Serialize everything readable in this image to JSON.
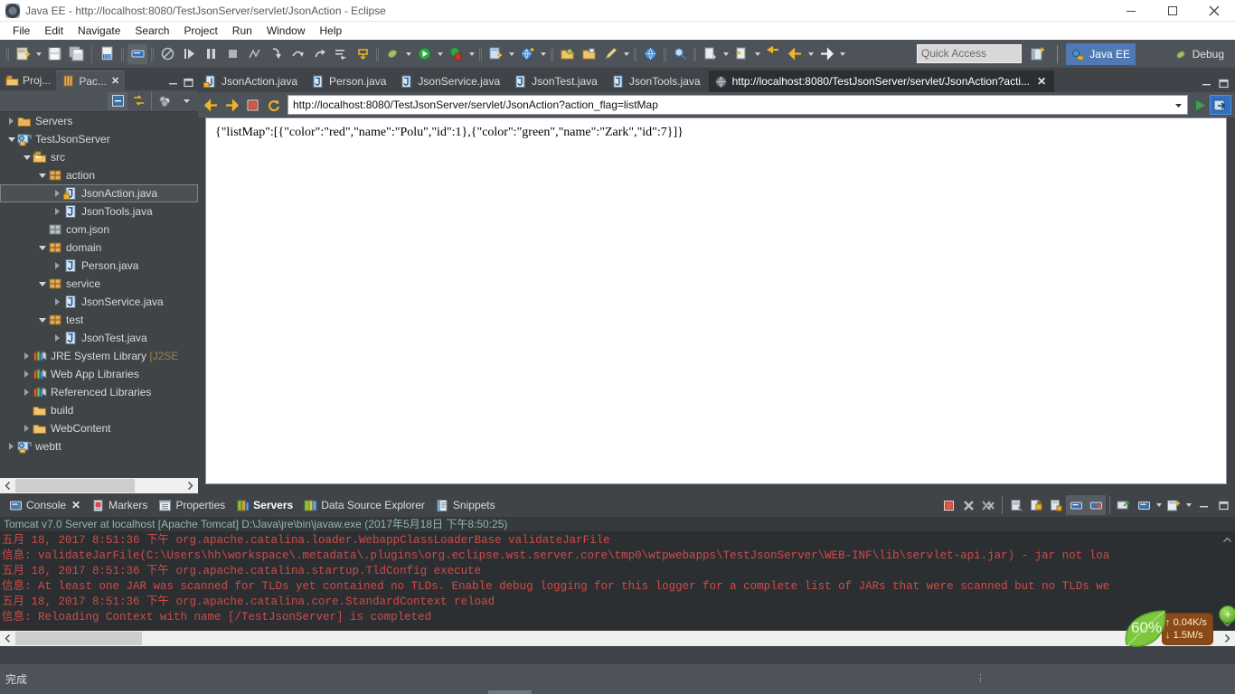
{
  "window": {
    "title": "Java EE - http://localhost:8080/TestJsonServer/servlet/JsonAction - Eclipse",
    "app_icon": "eclipse-icon",
    "minimize_label": "–",
    "restore_label": "❐",
    "close_label": "✕"
  },
  "menubar": {
    "items": [
      {
        "label": "File"
      },
      {
        "label": "Edit"
      },
      {
        "label": "Navigate"
      },
      {
        "label": "Search"
      },
      {
        "label": "Project"
      },
      {
        "label": "Run"
      },
      {
        "label": "Window"
      },
      {
        "label": "Help"
      }
    ]
  },
  "toolbar": {
    "quick_access_placeholder": "Quick Access",
    "open_perspective_icon": "open-perspective-icon",
    "perspectives": [
      {
        "label": "Java EE",
        "icon": "java-ee-perspective-icon",
        "active": true
      },
      {
        "label": "Debug",
        "icon": "debug-perspective-icon",
        "active": false
      }
    ],
    "groups": [
      {
        "icons": [
          "new-wizard-icon",
          "new-dropdown-icon",
          "save-icon",
          "save-all-icon"
        ]
      },
      {
        "icons": [
          "new-java-class-icon",
          "toggle-breakpoint-icon"
        ]
      },
      {
        "icons": [
          "skip-breakpoints-icon",
          "resume-icon",
          "suspend-icon",
          "terminate-icon",
          "disconnect-icon",
          "step-into-icon",
          "step-over-icon",
          "step-return-icon",
          "run-to-line-icon",
          "drop-to-frame-icon"
        ]
      },
      {
        "icons": [
          "external-tools-icon",
          "external-tools-dropdown-icon",
          "run-icon",
          "run-dropdown-icon",
          "debug-icon",
          "debug-dropdown-icon"
        ]
      },
      {
        "icons": [
          "new-ee-project-icon",
          "new-ee-dropdown-icon",
          "new-server-icon",
          "new-server-dropdown-icon"
        ]
      },
      {
        "icons": [
          "open-type-icon",
          "open-task-icon",
          "edit-icon",
          "edit-dropdown-icon"
        ]
      },
      {
        "icons": [
          "web-browser-icon"
        ]
      },
      {
        "icons": [
          "search-icon"
        ]
      },
      {
        "icons": [
          "next-annotation-icon",
          "previous-annotation-icon",
          "last-edit-location-icon"
        ]
      },
      {
        "icons": [
          "back-icon",
          "back-dropdown-icon",
          "forward-icon",
          "forward-dropdown-icon"
        ]
      }
    ]
  },
  "explorer": {
    "tabs": [
      {
        "label": "Proj...",
        "icon": "project-explorer-icon",
        "selected": false,
        "closable": false
      },
      {
        "label": "Pac...",
        "icon": "package-explorer-icon",
        "selected": true,
        "closable": true,
        "close_label": "✕"
      }
    ],
    "view_tools": [
      {
        "icon": "minimize-view-icon",
        "label": "–"
      },
      {
        "icon": "maximize-view-icon",
        "label": "❐"
      }
    ],
    "toolbar_icons": [
      {
        "icon": "collapse-all-icon"
      },
      {
        "icon": "link-with-editor-icon"
      },
      {
        "icon": "view-menu-filters-icon"
      },
      {
        "icon": "view-menu-icon"
      }
    ],
    "tree": [
      {
        "label": "Servers",
        "icon": "server-folder-icon",
        "indent": 0,
        "twisty": "closed",
        "selected": false
      },
      {
        "label": "TestJsonServer",
        "icon": "dynamic-web-project-icon",
        "indent": 0,
        "twisty": "open",
        "selected": false
      },
      {
        "label": "src",
        "icon": "source-folder-icon",
        "indent": 1,
        "twisty": "open",
        "selected": false
      },
      {
        "label": "action",
        "icon": "package-icon",
        "indent": 2,
        "twisty": "open",
        "selected": false
      },
      {
        "label": "JsonAction.java",
        "icon": "java-class-locked-icon",
        "indent": 3,
        "twisty": "closed",
        "selected": true
      },
      {
        "label": "JsonTools.java",
        "icon": "java-class-icon",
        "indent": 3,
        "twisty": "closed",
        "selected": false
      },
      {
        "label": "com.json",
        "icon": "package-empty-icon",
        "indent": 2,
        "twisty": "none",
        "selected": false
      },
      {
        "label": "domain",
        "icon": "package-icon",
        "indent": 2,
        "twisty": "open",
        "selected": false
      },
      {
        "label": "Person.java",
        "icon": "java-class-icon",
        "indent": 3,
        "twisty": "closed",
        "selected": false
      },
      {
        "label": "service",
        "icon": "package-icon",
        "indent": 2,
        "twisty": "open",
        "selected": false
      },
      {
        "label": "JsonService.java",
        "icon": "java-class-icon",
        "indent": 3,
        "twisty": "closed",
        "selected": false
      },
      {
        "label": "test",
        "icon": "package-icon",
        "indent": 2,
        "twisty": "open",
        "selected": false
      },
      {
        "label": "JsonTest.java",
        "icon": "java-class-icon",
        "indent": 3,
        "twisty": "closed",
        "selected": false
      },
      {
        "label": "JRE System Library ",
        "suffix": "[J2SE",
        "icon": "library-icon",
        "indent": 1,
        "twisty": "closed",
        "selected": false
      },
      {
        "label": "Web App Libraries",
        "icon": "library-icon",
        "indent": 1,
        "twisty": "closed",
        "selected": false
      },
      {
        "label": "Referenced Libraries",
        "icon": "library-icon",
        "indent": 1,
        "twisty": "closed",
        "selected": false
      },
      {
        "label": "build",
        "icon": "folder-icon",
        "indent": 1,
        "twisty": "none",
        "selected": false
      },
      {
        "label": "WebContent",
        "icon": "folder-icon",
        "indent": 1,
        "twisty": "closed",
        "selected": false
      },
      {
        "label": "webtt",
        "icon": "dynamic-web-project-icon",
        "indent": 0,
        "twisty": "closed",
        "selected": false
      }
    ]
  },
  "editor": {
    "tabs": [
      {
        "label": "JsonAction.java",
        "icon": "java-file-locked-icon",
        "selected": false
      },
      {
        "label": "Person.java",
        "icon": "java-file-icon",
        "selected": false
      },
      {
        "label": "JsonService.java",
        "icon": "java-file-icon",
        "selected": false
      },
      {
        "label": "JsonTest.java",
        "icon": "java-file-icon",
        "selected": false
      },
      {
        "label": "JsonTools.java",
        "icon": "java-file-icon",
        "selected": false
      },
      {
        "label": "http://localhost:8080/TestJsonServer/servlet/JsonAction?acti...",
        "icon": "web-browser-icon",
        "selected": true,
        "close_label": "✕"
      }
    ],
    "editor_tools": [
      {
        "icon": "minimize-editor-icon",
        "label": "–"
      },
      {
        "icon": "maximize-editor-icon",
        "label": "❐"
      }
    ],
    "browser": {
      "back_icon": "back-arrow-icon",
      "forward_icon": "forward-arrow-icon",
      "stop_icon": "stop-icon",
      "refresh_icon": "refresh-icon",
      "url_value": "http://localhost:8080/TestJsonServer/servlet/JsonAction?action_flag=listMap",
      "url_placeholder": "",
      "dropdown_icon": "chevron-down-icon",
      "go_icon": "go-icon",
      "open-external-icon": "open-external-browser-icon",
      "page_text": "{\"listMap\":[{\"color\":\"red\",\"name\":\"Polu\",\"id\":1},{\"color\":\"green\",\"name\":\"Zark\",\"id\":7}]}"
    }
  },
  "bottom_panel": {
    "tabs": [
      {
        "label": "Console",
        "icon": "console-icon",
        "selected": false,
        "closable": true,
        "close_label": "✕"
      },
      {
        "label": "Markers",
        "icon": "markers-icon",
        "selected": false,
        "closable": false
      },
      {
        "label": "Properties",
        "icon": "properties-icon",
        "selected": false,
        "closable": false
      },
      {
        "label": "Servers",
        "icon": "servers-icon",
        "selected": true,
        "closable": false
      },
      {
        "label": "Data Source Explorer",
        "icon": "data-source-explorer-icon",
        "selected": false,
        "closable": false
      },
      {
        "label": "Snippets",
        "icon": "snippets-icon",
        "selected": false,
        "closable": false
      }
    ],
    "tools": [
      {
        "icon": "terminate-console-icon"
      },
      {
        "icon": "remove-launch-icon"
      },
      {
        "icon": "remove-all-terminated-icon"
      },
      {
        "icon": "clear-console-icon"
      },
      {
        "icon": "scroll-lock-icon"
      },
      {
        "icon": "pin-console-icon"
      },
      {
        "icon": "display-selected-console-icon"
      },
      {
        "icon": "open-console-error-icon"
      },
      {
        "icon": "show-console-on-output-icon"
      },
      {
        "icon": "display-console-icon"
      },
      {
        "icon": "display-console-dropdown-icon"
      },
      {
        "icon": "open-console-icon"
      },
      {
        "icon": "open-console-dropdown-icon"
      },
      {
        "icon": "minimize-panel-icon"
      },
      {
        "icon": "maximize-panel-icon"
      }
    ],
    "console_title": "Tomcat v7.0 Server at localhost [Apache Tomcat] D:\\Java\\jre\\bin\\javaw.exe (2017年5月18日 下午8:50:25)",
    "console_lines": [
      "五月 18, 2017 8:51:36 下午 org.apache.catalina.loader.WebappClassLoaderBase validateJarFile",
      "信息: validateJarFile(C:\\Users\\hh\\workspace\\.metadata\\.plugins\\org.eclipse.wst.server.core\\tmp0\\wtpwebapps\\TestJsonServer\\WEB-INF\\lib\\servlet-api.jar) - jar not loa",
      "五月 18, 2017 8:51:36 下午 org.apache.catalina.startup.TldConfig execute",
      "信息: At least one JAR was scanned for TLDs yet contained no TLDs. Enable debug logging for this logger for a complete list of JARs that were scanned but no TLDs we",
      "五月 18, 2017 8:51:36 下午 org.apache.catalina.core.StandardContext reload",
      "信息: Reloading Context with name [/TestJsonServer] is completed"
    ]
  },
  "statusbar": {
    "text": "完成",
    "dots": "⋮"
  },
  "speed_widget": {
    "percent": "60%",
    "upload": "0.04K/s",
    "download": "1.5M/s",
    "upload_arrow": "↑",
    "download_arrow": "↓",
    "plus_label": "+",
    "leaf_icon": "leaf-icon"
  },
  "colors": {
    "accent_blue": "#4f7ab5",
    "console_red": "#d24a4a",
    "console_title": "#8fb8b4",
    "toolbar_bg": "#4d5358",
    "panel_bg": "#404448",
    "editor_bg": "#2b2f31"
  }
}
